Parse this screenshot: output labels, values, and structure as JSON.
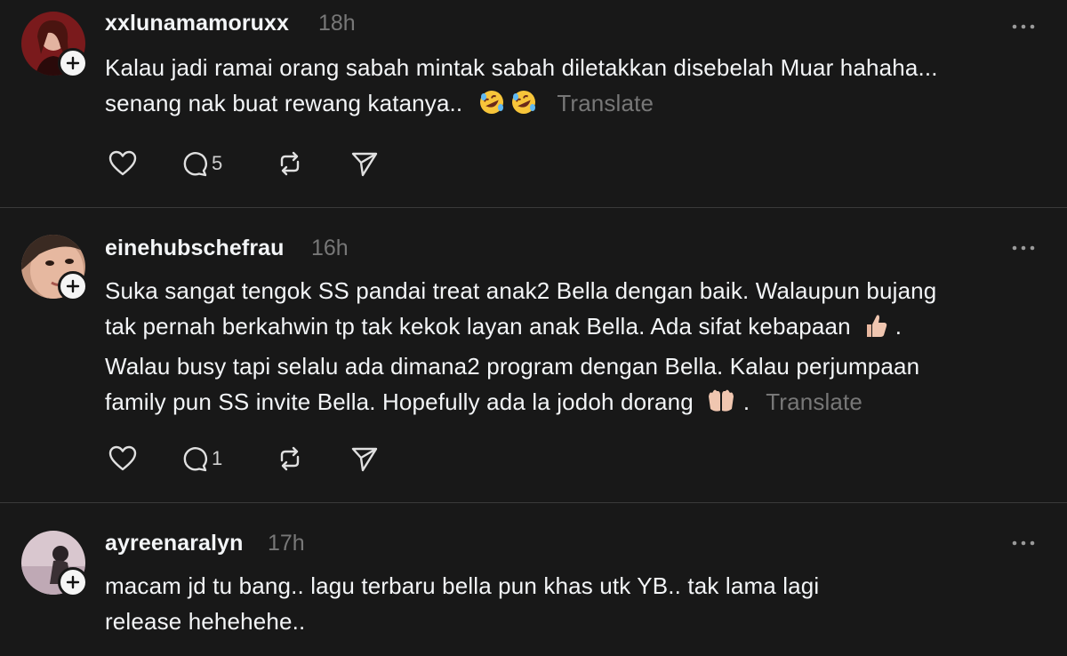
{
  "comments": [
    {
      "username": "xxlunamamoruxx",
      "time": "18h",
      "lines": [
        "Kalau jadi ramai orang sabah mintak sabah diletakkan disebelah Muar hahaha...",
        "senang nak buat rewang katanya.."
      ],
      "emoji": [
        "rolling-laughing-emoji",
        "rolling-laughing-emoji"
      ],
      "translate_label": "Translate",
      "reply_count": "5"
    },
    {
      "username": "einehubschefrau",
      "time": "16h",
      "lines": [
        "Suka sangat tengok SS pandai treat anak2 Bella dengan baik. Walaupun bujang",
        "tak pernah berkahwin tp tak kekok layan anak Bella. Ada sifat kebapaan",
        "Walau busy tapi selalu ada dimana2 program dengan Bella. Kalau perjumpaan",
        "family pun SS invite Bella. Hopefully ada la jodoh dorang"
      ],
      "line2_suffix": ".",
      "line4_suffix": ".",
      "emoji": [
        "thumbs-up-emoji",
        "open-hands-emoji"
      ],
      "translate_label": "Translate",
      "reply_count": "1"
    },
    {
      "username": "ayreenaralyn",
      "time": "17h",
      "lines": [
        "macam jd tu bang.. lagu terbaru bella pun khas utk YB.. tak lama lagi",
        "release hehehehe.."
      ]
    }
  ],
  "colors": {
    "background": "#181818",
    "text": "#f3f5f7",
    "secondary": "#777777",
    "divider": "#3a3a3a"
  }
}
